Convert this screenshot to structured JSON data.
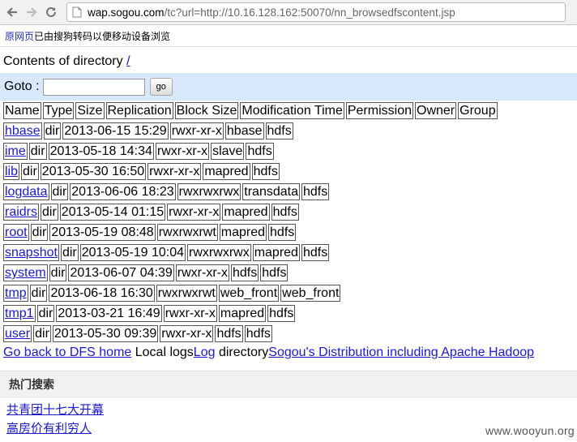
{
  "browser": {
    "url_host": "wap.sogou.com",
    "url_rest": "/tc?url=http://10.16.128.162:50070/nn_browsedfscontent.jsp"
  },
  "sogou": {
    "original_link": "原网页",
    "notice": "已由搜狗转码以便移动设备浏览"
  },
  "hdfs": {
    "contents_label": "Contents of directory ",
    "dir_link": "/",
    "goto_label": "Goto : ",
    "goto_value": "",
    "go_button": "go",
    "headers": [
      "Name",
      "Type",
      "Size",
      "Replication",
      "Block Size",
      "Modification Time",
      "Permission",
      "Owner",
      "Group"
    ],
    "rows": [
      {
        "name": "hbase",
        "type": "dir",
        "mtime": "2013-06-15 15:29",
        "perm": "rwxr-xr-x",
        "owner": "hbase",
        "group": "hdfs"
      },
      {
        "name": "ime",
        "type": "dir",
        "mtime": "2013-05-18 14:34",
        "perm": "rwxr-xr-x",
        "owner": "slave",
        "group": "hdfs"
      },
      {
        "name": "lib",
        "type": "dir",
        "mtime": "2013-05-30 16:50",
        "perm": "rwxr-xr-x",
        "owner": "mapred",
        "group": "hdfs"
      },
      {
        "name": "logdata",
        "type": "dir",
        "mtime": "2013-06-06 18:23",
        "perm": "rwxrwxrwx",
        "owner": "transdata",
        "group": "hdfs"
      },
      {
        "name": "raidrs",
        "type": "dir",
        "mtime": "2013-05-14 01:15",
        "perm": "rwxr-xr-x",
        "owner": "mapred",
        "group": "hdfs"
      },
      {
        "name": "root",
        "type": "dir",
        "mtime": "2013-05-19 08:48",
        "perm": "rwxrwxrwt",
        "owner": "mapred",
        "group": "hdfs"
      },
      {
        "name": "snapshot",
        "type": "dir",
        "mtime": "2013-05-19 10:04",
        "perm": "rwxrwxrwx",
        "owner": "mapred",
        "group": "hdfs"
      },
      {
        "name": "system",
        "type": "dir",
        "mtime": "2013-06-07 04:39",
        "perm": "rwxr-xr-x",
        "owner": "hdfs",
        "group": "hdfs"
      },
      {
        "name": "tmp",
        "type": "dir",
        "mtime": "2013-06-18 16:30",
        "perm": "rwxrwxrwt",
        "owner": "web_front",
        "group": "web_front"
      },
      {
        "name": "tmp1",
        "type": "dir",
        "mtime": "2013-03-21 16:49",
        "perm": "rwxr-xr-x",
        "owner": "mapred",
        "group": "hdfs"
      },
      {
        "name": "user",
        "type": "dir",
        "mtime": "2013-05-30 09:39",
        "perm": "rwxr-xr-x",
        "owner": "hdfs",
        "group": "hdfs"
      }
    ],
    "footer": {
      "back_link": "Go back to DFS home",
      "local_logs": " Local logs",
      "log_link": "Log",
      "directory_text": " directory",
      "distribution_link": "Sogou's Distribution including Apache Hadoop"
    }
  },
  "hot_search": {
    "title": "热门搜索",
    "items": [
      "共青团十七大开幕",
      "高房价有利穷人"
    ]
  },
  "watermark": "www.wooyun.org"
}
